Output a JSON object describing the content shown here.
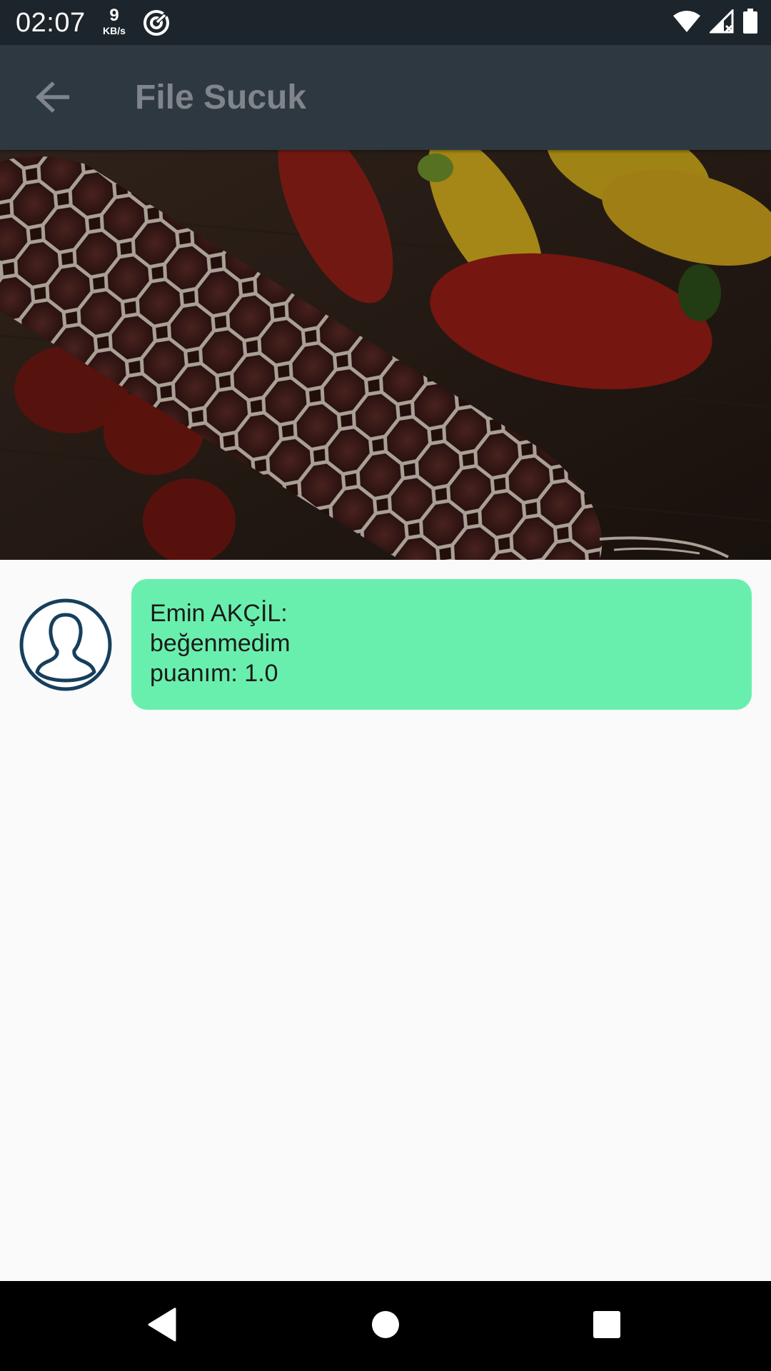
{
  "status_bar": {
    "time": "02:07",
    "net_speed_value": "9",
    "net_speed_unit": "KB/s",
    "icons": [
      "data-saver-icon",
      "wifi-icon",
      "cell-signal-icon",
      "battery-icon"
    ]
  },
  "app_bar": {
    "back_icon": "arrow-left-icon",
    "title": "File Sucuk"
  },
  "hero_image": {
    "subject": "sucuk with peppers and tomatoes"
  },
  "comments": [
    {
      "avatar_icon": "user-avatar-icon",
      "author": "Emin AKÇİL:",
      "text": "beğenmedim",
      "rating": "puanım: 1.0"
    }
  ],
  "nav_bar": {
    "icons": [
      "back-triangle-icon",
      "home-circle-icon",
      "recents-square-icon"
    ]
  },
  "colors": {
    "status_bar": "#1d252c",
    "app_bar": "#2e3840",
    "title_text": "#7f858a",
    "bubble": "#69efad",
    "avatar_stroke": "#163f5c",
    "background": "#fafafa"
  }
}
